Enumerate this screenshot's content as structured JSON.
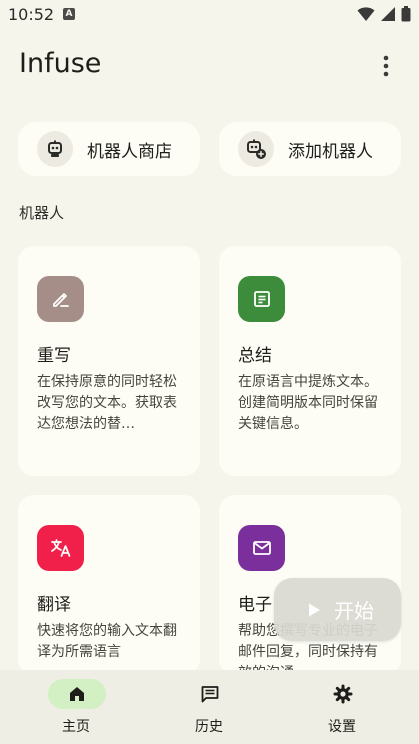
{
  "status_bar": {
    "time": "10:52",
    "notification_glyph": "A"
  },
  "header": {
    "title": "Infuse"
  },
  "quick_actions": {
    "store": {
      "label": "机器人商店",
      "icon": "robot-icon"
    },
    "add": {
      "label": "添加机器人",
      "icon": "robot-add-icon"
    }
  },
  "section": {
    "title": "机器人"
  },
  "bots": [
    {
      "title": "重写",
      "description": "在保持原意的同时轻松改写您的文本。获取表达您想法的替…",
      "icon": "edit-icon",
      "color": "#a58e87"
    },
    {
      "title": "总结",
      "description": "在原语言中提炼文本。创建简明版本同时保留关键信息。",
      "icon": "summary-icon",
      "color": "#3c8c3b"
    },
    {
      "title": "翻译",
      "description": "快速将您的输入文本翻译为所需语言",
      "icon": "translate-icon",
      "color": "#f0204a"
    },
    {
      "title": "电子",
      "description": "帮助您撰写专业的电子邮件回复，同时保持有效的沟通",
      "icon": "email-icon",
      "color": "#7a2f9c"
    }
  ],
  "fab": {
    "label": "开始",
    "icon": "play-icon"
  },
  "bottom_nav": [
    {
      "label": "主页",
      "icon": "home-icon",
      "active": true
    },
    {
      "label": "历史",
      "icon": "history-icon",
      "active": false
    },
    {
      "label": "设置",
      "icon": "settings-icon",
      "active": false
    }
  ],
  "colors": {
    "background": "#f6f5ec",
    "card": "#fdfdf6",
    "nav_active_pill": "#d3efc4",
    "nav_background": "#efeee4"
  }
}
